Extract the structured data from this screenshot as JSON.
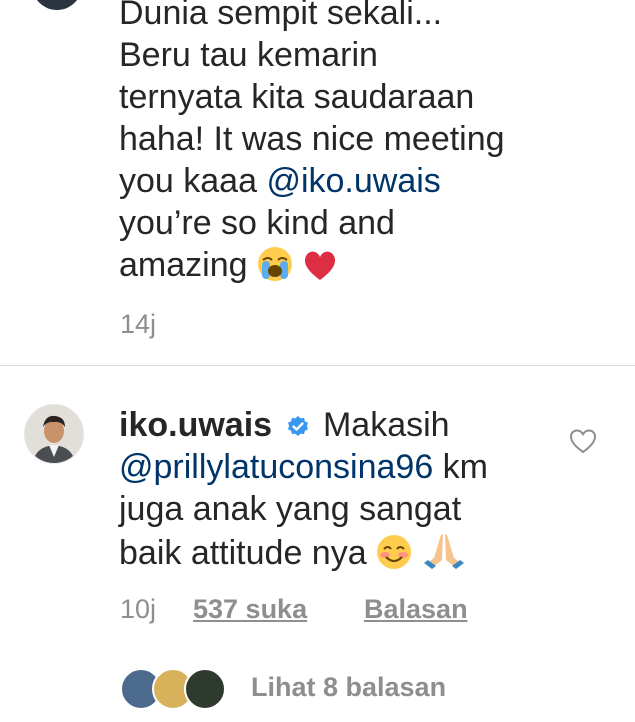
{
  "top_comment": {
    "line1": "Dunia sempit sekali...",
    "line2": "Beru tau kemarin",
    "line3": "ternyata kita saudaraan",
    "line4": "haha! It was nice meeting",
    "line5_pre": "you kaaa ",
    "mention": "@iko.uwais",
    "line6": "you’re so kind and",
    "line7": "amazing",
    "time": "14j"
  },
  "reply": {
    "username": "iko.uwais",
    "text_first": "Makasih",
    "mention": "@prillylatuconsina96",
    "text_after_mention": " km",
    "line3": "juga anak yang sangat",
    "line4": "baik attitude nya",
    "time": "10j",
    "likes": "537 suka",
    "reply_label": "Balasan",
    "view_replies": "Lihat 8 balasan"
  },
  "colors": {
    "text": "#262626",
    "mention": "#003569",
    "meta": "#8e8e8e",
    "verified": "#3897f0",
    "divider": "#dbdbdb"
  },
  "icons": [
    "verified-badge-icon",
    "heart-icon",
    "loudly-crying-face-emoji",
    "red-heart-emoji",
    "smiling-face-emoji",
    "folded-hands-emoji"
  ]
}
